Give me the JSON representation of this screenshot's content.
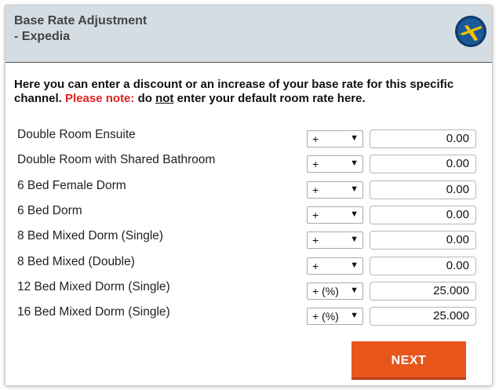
{
  "header": {
    "title": "Base Rate Adjustment\n- Expedia",
    "logo_icon": "expedia-plane-globe-icon"
  },
  "intro": {
    "text_before": "Here you can enter a discount or an increase of your base rate for this specific channel. ",
    "note_label": "Please note:",
    "text_mid": " do ",
    "emphasis": "not",
    "text_after": " enter your default room rate here."
  },
  "rooms": [
    {
      "name": "Double Room Ensuite",
      "operator": "+",
      "amount": "0.00"
    },
    {
      "name": "Double Room with Shared Bathroom",
      "operator": "+",
      "amount": "0.00"
    },
    {
      "name": "6 Bed Female Dorm",
      "operator": "+",
      "amount": "0.00"
    },
    {
      "name": "6 Bed Dorm",
      "operator": "+",
      "amount": "0.00"
    },
    {
      "name": "8 Bed Mixed Dorm (Single)",
      "operator": "+",
      "amount": "0.00"
    },
    {
      "name": "8 Bed Mixed (Double)",
      "operator": "+",
      "amount": "0.00"
    },
    {
      "name": "12 Bed Mixed Dorm (Single)",
      "operator": "+ (%)",
      "amount": "25.000"
    },
    {
      "name": "16 Bed Mixed Dorm (Single)",
      "operator": "+ (%)",
      "amount": "25.000"
    }
  ],
  "next_label": "NEXT",
  "colors": {
    "header_bg": "#d4dde3",
    "warning": "#e02020",
    "button": "#e8561c"
  }
}
